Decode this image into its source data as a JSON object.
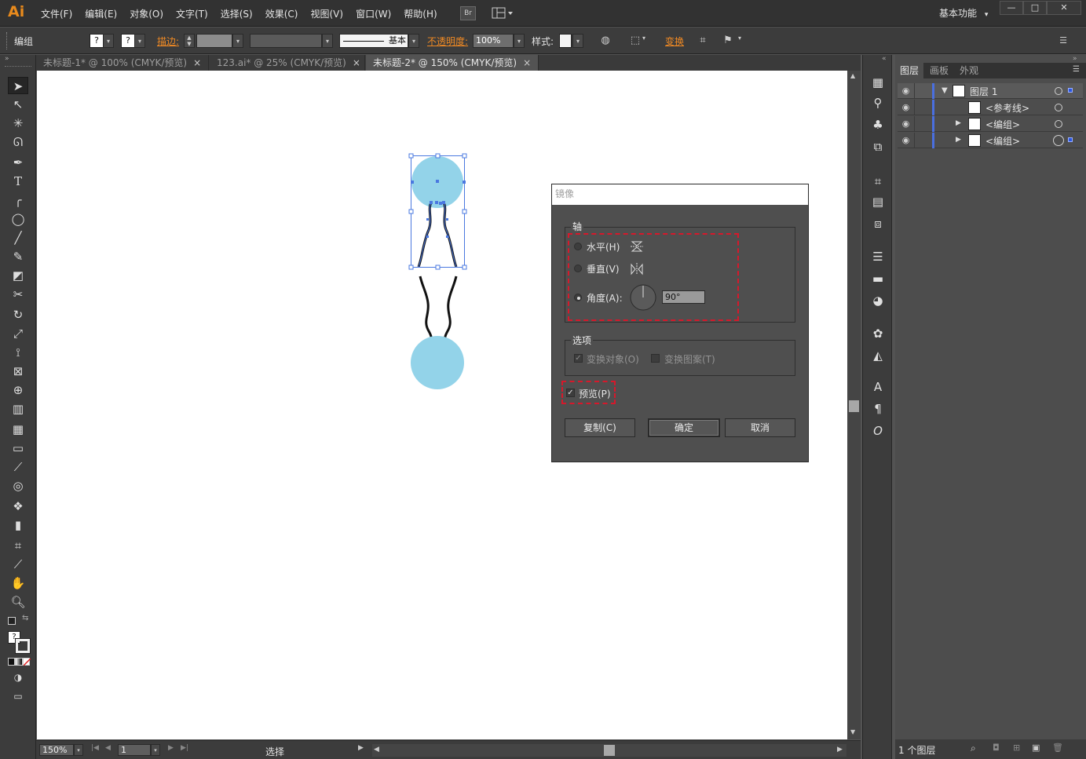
{
  "app": {
    "logo": "Ai",
    "menus": [
      "文件(F)",
      "编辑(E)",
      "对象(O)",
      "文字(T)",
      "选择(S)",
      "效果(C)",
      "视图(V)",
      "窗口(W)",
      "帮助(H)"
    ],
    "bridge_icon": "Br",
    "workspace": "基本功能",
    "workspace_caret": "▾",
    "window_controls": [
      "—",
      "□",
      "✕"
    ]
  },
  "control_bar": {
    "selection_type": "编组",
    "fill_marker": "?",
    "stroke_marker": "?",
    "stroke_label": "描边:",
    "stroke_profile_label": "基本",
    "opacity_label": "不透明度:",
    "opacity_value": "100%",
    "style_label": "样式:",
    "transform_label": "变换",
    "caret": "▾",
    "panel_menu": "☰"
  },
  "tabs": [
    {
      "label": "未标题-1* @ 100% (CMYK/预览)",
      "close": "×",
      "active": false
    },
    {
      "label": "123.ai* @ 25% (CMYK/预览)",
      "close": "×",
      "active": false
    },
    {
      "label": "未标题-2* @ 150% (CMYK/预览)",
      "close": "×",
      "active": true
    }
  ],
  "status_bar": {
    "zoom": "150%",
    "artboard": "1",
    "tool": "选择"
  },
  "layers_panel": {
    "tabs": [
      "图层",
      "画板",
      "外观"
    ],
    "rows": [
      {
        "name": "图层 1",
        "expander": "▼"
      },
      {
        "name": "<参考线>",
        "expander": ""
      },
      {
        "name": "<编组>",
        "expander": "▶"
      },
      {
        "name": "<编组>",
        "expander": "▶"
      }
    ],
    "eye": "◉",
    "footer_count": "1 个图层"
  },
  "dialog": {
    "title": "镜像",
    "axis_group": "轴",
    "horizontal_label": "水平(H)",
    "vertical_label": "垂直(V)",
    "angle_label": "角度(A):",
    "angle_value": "90°",
    "options_group": "选项",
    "transform_objects_label": "变换对象(O)",
    "transform_patterns_label": "变换图案(T)",
    "preview_label": "预览(P)",
    "copy_button": "复制(C)",
    "ok_button": "确定",
    "cancel_button": "取消",
    "checkmark": "✓",
    "axis_selection": "angle",
    "transform_objects_checked": true,
    "transform_patterns_checked": false,
    "preview_checked": true
  },
  "artwork": {
    "circle_color": "#93d3e9",
    "selection_color": "#4a78e0"
  },
  "colors": {
    "accent_orange": "#f08a24",
    "highlight_red": "#d6182b",
    "layer_blue": "#4a6fe0"
  }
}
